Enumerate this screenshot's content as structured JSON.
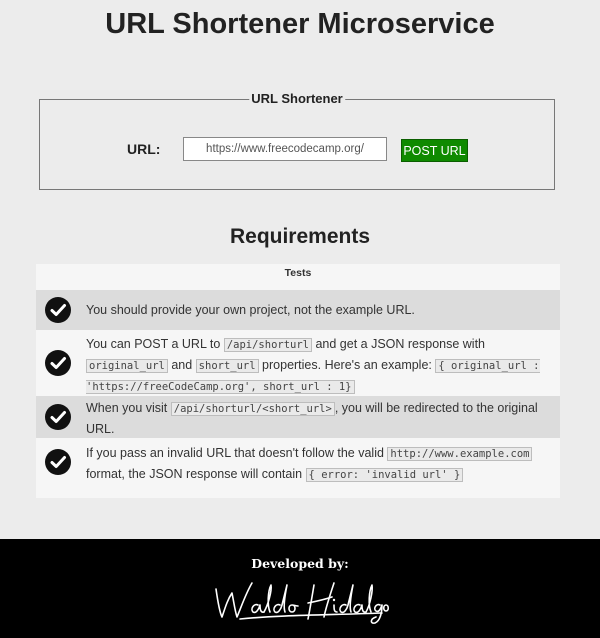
{
  "header": {
    "title": "URL Shortener Microservice"
  },
  "form": {
    "legend": "URL Shortener",
    "url_label": "URL:",
    "url_value": "https://www.freecodecamp.org/",
    "submit_label": "POST URL"
  },
  "requirements": {
    "title": "Requirements",
    "tests_header": "Tests",
    "items": [
      {
        "segments": [
          {
            "text": "You should provide your own project, not the example URL."
          }
        ]
      },
      {
        "segments": [
          {
            "text": "You can POST a URL to "
          },
          {
            "code": "/api/shorturl"
          },
          {
            "text": " and get a JSON response with "
          },
          {
            "code": "original_url"
          },
          {
            "text": " and "
          },
          {
            "code": "short_url"
          },
          {
            "text": " properties. Here's an example: "
          },
          {
            "code": "{ original_url : 'https://freeCodeCamp.org', short_url : 1}"
          }
        ]
      },
      {
        "segments": [
          {
            "text": "When you visit "
          },
          {
            "code": "/api/shorturl/<short_url>"
          },
          {
            "text": ", you will be redirected to the original URL."
          }
        ]
      },
      {
        "segments": [
          {
            "text": "If you pass an invalid URL that doesn't follow the valid "
          },
          {
            "code": "http://www.example.com"
          },
          {
            "text": " format, the JSON response will contain "
          },
          {
            "code": "{ error: 'invalid url' }"
          }
        ]
      }
    ]
  },
  "footer": {
    "developed_by_label": "Developed by:",
    "signature": "Waldo Hidalgo"
  },
  "colors": {
    "button": "#0f8a00",
    "footer_bg": "#000000",
    "page_bg": "#ececec"
  },
  "icons": {
    "test_status": "check-circle-icon"
  }
}
